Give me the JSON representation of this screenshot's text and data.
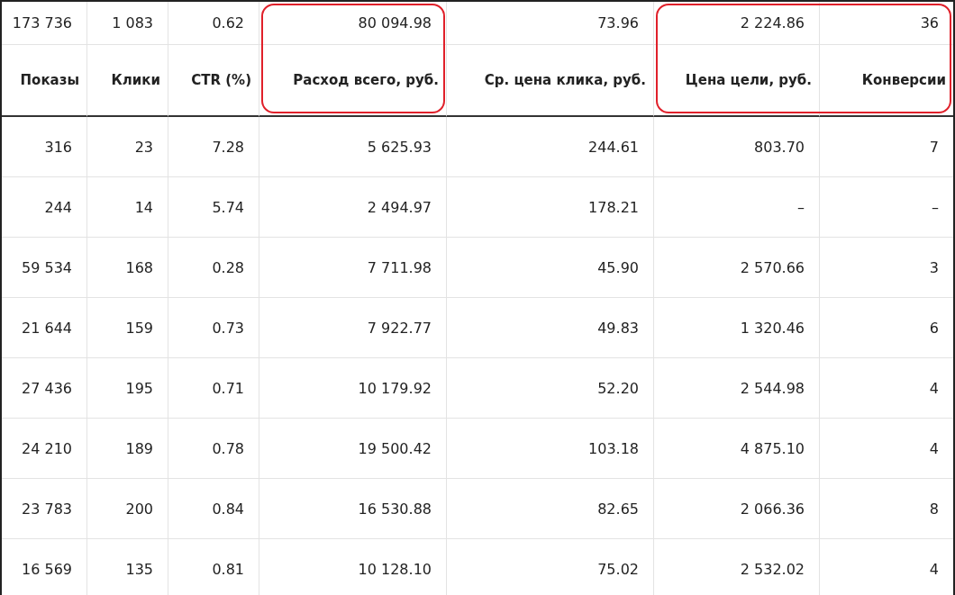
{
  "columns": [
    {
      "label": "Показы",
      "total": "173 736",
      "highlighted": false
    },
    {
      "label": "Клики",
      "total": "1 083",
      "highlighted": false
    },
    {
      "label": "CTR (%)",
      "total": "0.62",
      "highlighted": false
    },
    {
      "label": "Расход всего, руб.",
      "total": "80 094.98",
      "highlighted": true
    },
    {
      "label": "Ср. цена клика, руб.",
      "total": "73.96",
      "highlighted": false
    },
    {
      "label": "Цена цели, руб.",
      "total": "2 224.86",
      "highlighted": true
    },
    {
      "label": "Конверсии",
      "total": "36",
      "highlighted": true
    }
  ],
  "rows": [
    [
      "316",
      "23",
      "7.28",
      "5 625.93",
      "244.61",
      "803.70",
      "7"
    ],
    [
      "244",
      "14",
      "5.74",
      "2 494.97",
      "178.21",
      "–",
      "–"
    ],
    [
      "59 534",
      "168",
      "0.28",
      "7 711.98",
      "45.90",
      "2 570.66",
      "3"
    ],
    [
      "21 644",
      "159",
      "0.73",
      "7 922.77",
      "49.83",
      "1 320.46",
      "6"
    ],
    [
      "27 436",
      "195",
      "0.71",
      "10 179.92",
      "52.20",
      "2 544.98",
      "4"
    ],
    [
      "24 210",
      "189",
      "0.78",
      "19 500.42",
      "103.18",
      "4 875.10",
      "4"
    ],
    [
      "23 783",
      "200",
      "0.84",
      "16 530.88",
      "82.65",
      "2 066.36",
      "8"
    ],
    [
      "16 569",
      "135",
      "0.81",
      "10 128.10",
      "75.02",
      "2 532.02",
      "4"
    ]
  ]
}
